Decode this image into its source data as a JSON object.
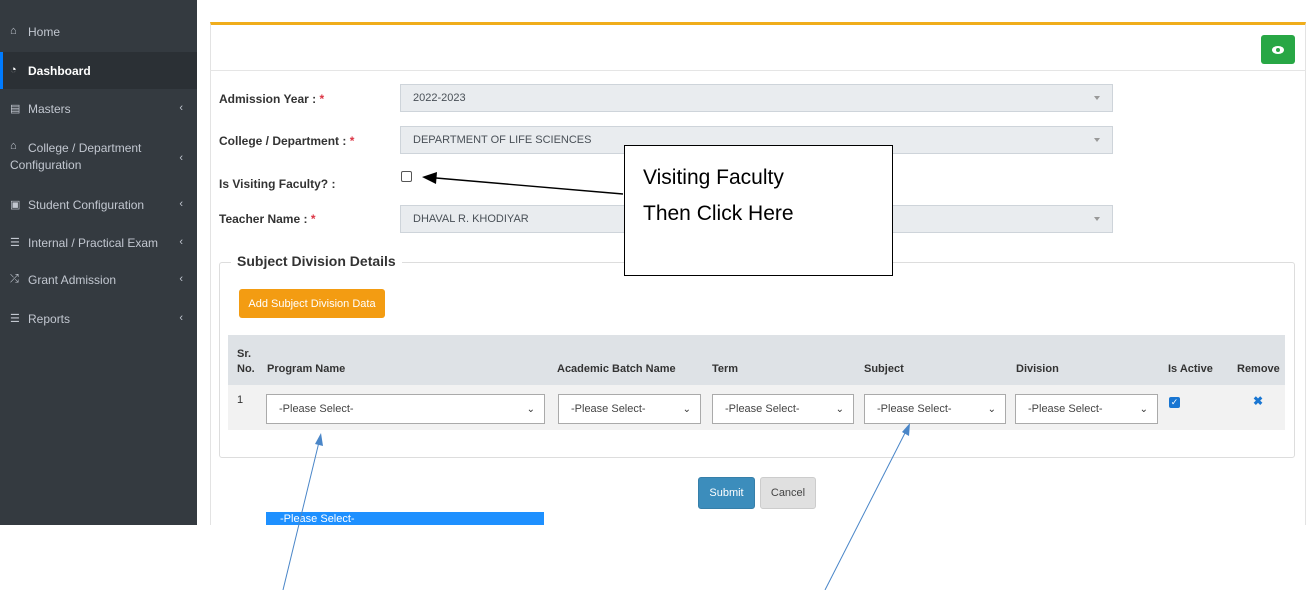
{
  "sidebar": {
    "items": [
      {
        "label": "Home",
        "icon": "home-icon",
        "glyph": "⌂",
        "chevron": ""
      },
      {
        "label": "Dashboard",
        "icon": "dashboard-icon",
        "glyph": "◔",
        "chevron": ""
      },
      {
        "label": "Masters",
        "icon": "book-icon",
        "glyph": "▤",
        "chevron": "‹"
      },
      {
        "label": "College / Department Configuration",
        "icon": "building-icon",
        "glyph": "⌂",
        "chevron": "‹"
      },
      {
        "label": "Student Configuration",
        "icon": "id-card-icon",
        "glyph": "▣",
        "chevron": "‹"
      },
      {
        "label": "Internal / Practical Exam",
        "icon": "list-icon",
        "glyph": "☰",
        "chevron": "‹"
      },
      {
        "label": "Grant Admission",
        "icon": "shuffle-icon",
        "glyph": "⤮",
        "chevron": "‹"
      },
      {
        "label": "Reports",
        "icon": "list-icon",
        "glyph": "☰",
        "chevron": "‹"
      }
    ]
  },
  "form": {
    "admission_year_label": "Admission Year :",
    "admission_year_value": "2022-2023",
    "college_label": "College / Department :",
    "college_value": "DEPARTMENT OF LIFE SCIENCES",
    "visiting_label": "Is Visiting Faculty? :",
    "teacher_label": "Teacher Name :",
    "teacher_value": "DHAVAL R. KHODIYAR",
    "required_mark": "*"
  },
  "subject_division": {
    "legend": "Subject Division Details",
    "add_button": "Add Subject Division Data",
    "columns": {
      "sr": "Sr.",
      "no": "No.",
      "program": "Program Name",
      "batch": "Academic Batch Name",
      "term": "Term",
      "subject": "Subject",
      "division": "Division",
      "active": "Is Active",
      "remove": "Remove"
    },
    "row": {
      "num": "1",
      "program": "-Please Select-",
      "batch": "-Please Select-",
      "term": "-Please Select-",
      "subject": "-Please Select-",
      "division": "-Please Select-",
      "active_checked": true
    }
  },
  "actions": {
    "submit": "Submit",
    "cancel": "Cancel"
  },
  "dropdown_option": "-Please Select-",
  "callout": {
    "line1": "Visiting Faculty",
    "line2": "Then Click Here"
  },
  "colors": {
    "sidebar_bg": "#343a40",
    "accent_border": "#f0ad1b",
    "eye_button": "#28a745",
    "add_button": "#f39c12",
    "submit_button": "#3c8dbc",
    "annotation_arrow": "#4a86c8"
  }
}
